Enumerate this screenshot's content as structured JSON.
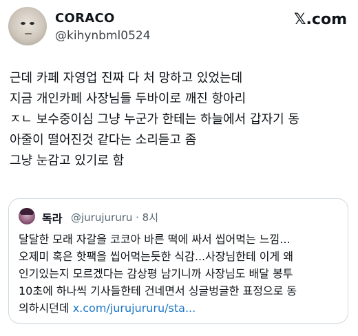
{
  "author": {
    "name": "CORACO",
    "handle": "@kihynbml0524"
  },
  "brand": "𝕏.com",
  "tweet_lines": [
    "근데 카페 자영업 진짜 다 처 망하고 있었는데",
    "지금 개인카페 사장님들 두바이로 깨진 항아리",
    "ㅈㄴ 보수중이심 그냥 누군가 한테는 하늘에서 갑자기 동",
    "아줄이 떨어진것 같다는 소리듣고 좀",
    "그냥 눈감고 있기로 함"
  ],
  "quoted": {
    "name": "독라",
    "handle_time": "@jurujururu · 8시",
    "lines": [
      "달달한 모래 자갈을 코코아 바른 떡에 싸서 씹어먹는 느낌...",
      "오제미 혹은 핫팩을 씹어먹는듯한 식감...사장님한테 이게 왜",
      "인기있는지 모르겠다는 감상평 남기니까 사장님도 배달 봉투",
      "10초에 하나씩 기사들한테 건네면서 싱글벙글한 표정으로 동"
    ],
    "last_line_text": "의하시던데 ",
    "link": "x.com/jurujururu/sta..."
  }
}
